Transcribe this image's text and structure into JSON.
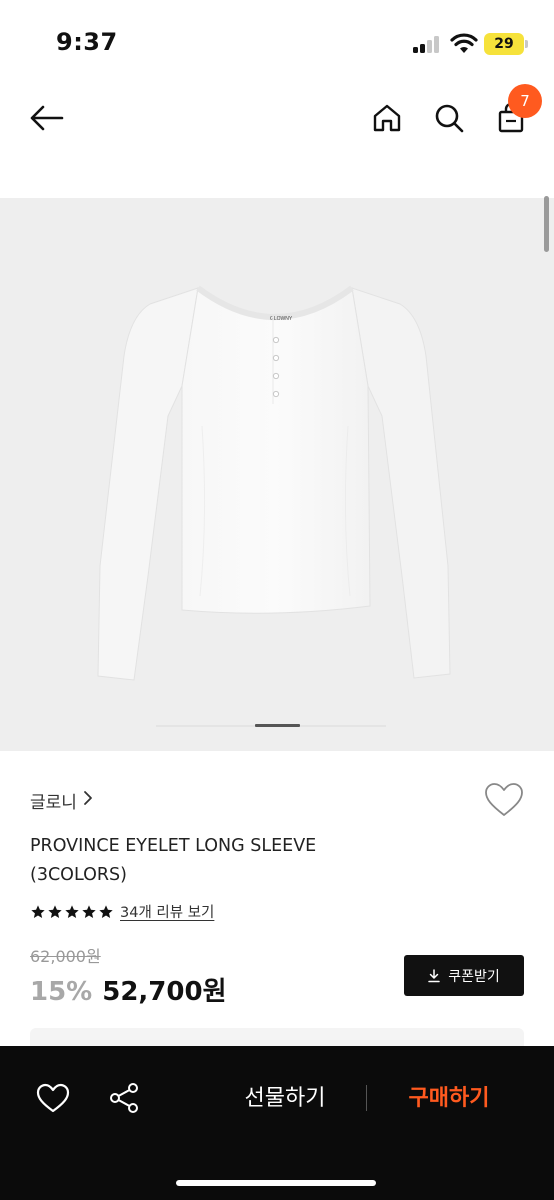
{
  "status_bar": {
    "time": "9:37",
    "battery": "29"
  },
  "nav": {
    "cart_count": "7"
  },
  "product": {
    "brand": "글로니",
    "title": "PROVINCE EYELET LONG SLEEVE (3COLORS)",
    "label_text": "GLOWNY",
    "rating_stars": 5,
    "review_link": "34개 리뷰 보기",
    "original_price": "62,000원",
    "discount": "15%",
    "sale_price": "52,700원",
    "coupon_label": "쿠폰받기"
  },
  "gallery": {
    "image_count_indicator": "1"
  },
  "bottom_bar": {
    "gift_label": "선물하기",
    "buy_label": "구매하기"
  },
  "colors": {
    "accent": "#ff5a1f",
    "bottom_bar": "#0b0b0b",
    "hero_bg": "#eeeeee"
  }
}
